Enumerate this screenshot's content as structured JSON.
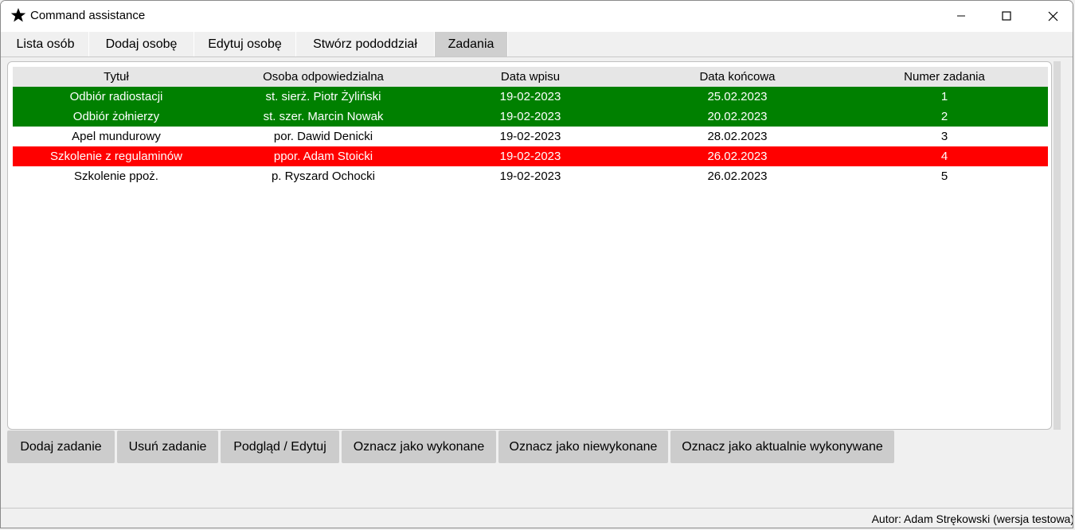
{
  "window": {
    "title": "Command assistance",
    "icon": "star-icon"
  },
  "tabs": [
    {
      "label": "Lista osób",
      "active": false
    },
    {
      "label": "Dodaj osobę",
      "active": false
    },
    {
      "label": "Edytuj osobę",
      "active": false
    },
    {
      "label": "Stwórz pododdział",
      "active": false
    },
    {
      "label": "Zadania",
      "active": true
    }
  ],
  "table": {
    "headers": [
      "Tytuł",
      "Osoba odpowiedzialna",
      "Data wpisu",
      "Data końcowa",
      "Numer zadania"
    ],
    "rows": [
      {
        "status": "done",
        "cells": [
          "Odbiór radiostacji",
          "st. sierż. Piotr Żyliński",
          "19-02-2023",
          "25.02.2023",
          "1"
        ]
      },
      {
        "status": "done",
        "cells": [
          "Odbiór żołnierzy",
          "st. szer. Marcin Nowak",
          "19-02-2023",
          "20.02.2023",
          "2"
        ]
      },
      {
        "status": "none",
        "cells": [
          "Apel mundurowy",
          "por. Dawid Denicki",
          "19-02-2023",
          "28.02.2023",
          "3"
        ]
      },
      {
        "status": "not-done",
        "cells": [
          "Szkolenie z regulaminów",
          "ppor. Adam Stoicki",
          "19-02-2023",
          "26.02.2023",
          "4"
        ]
      },
      {
        "status": "none",
        "cells": [
          "Szkolenie ppoż.",
          "p. Ryszard Ochocki",
          "19-02-2023",
          "26.02.2023",
          "5"
        ]
      }
    ]
  },
  "buttons": {
    "add": "Dodaj zadanie",
    "delete": "Usuń zadanie",
    "preview_edit": "Podgląd / Edytuj",
    "mark_done": "Oznacz jako wykonane",
    "mark_not_done": "Oznacz jako niewykonane",
    "mark_in_progress": "Oznacz jako aktualnie wykonywane"
  },
  "status_bar": {
    "author": "Autor: Adam Strękowski (wersja testowa)"
  },
  "colors": {
    "done": "#008000",
    "not_done": "#ff0000",
    "row_text_highlight": "#ffffff",
    "header_bg": "#e6e6e6",
    "button_bg": "#cccccc",
    "active_tab_bg": "#cfcfcf"
  }
}
